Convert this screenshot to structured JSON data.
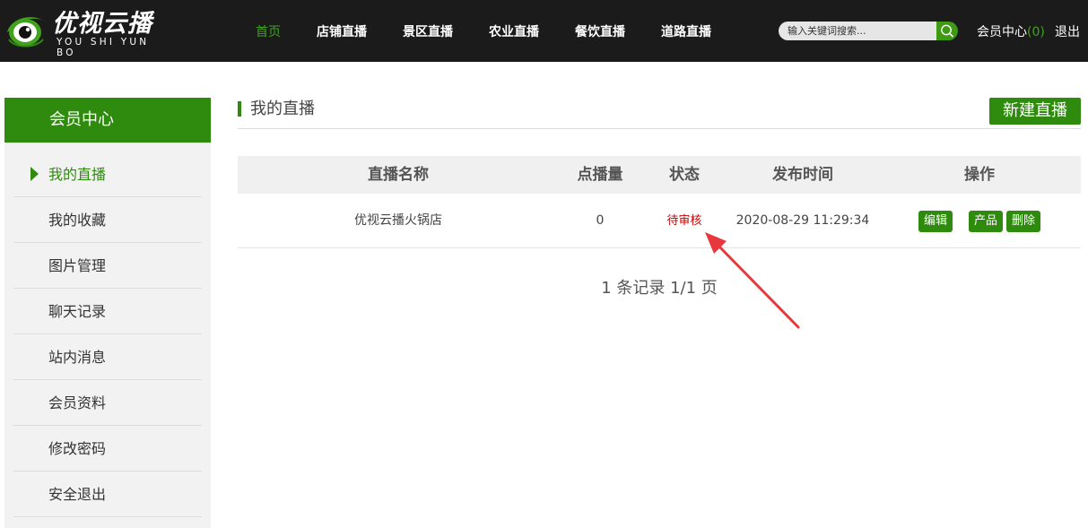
{
  "logo": {
    "name_cn": "优视云播",
    "name_en": "YOU SHI YUN BO",
    "brand_color": "#41a21b"
  },
  "nav": {
    "items": [
      {
        "label": "首页",
        "active": true
      },
      {
        "label": "店铺直播",
        "active": false
      },
      {
        "label": "景区直播",
        "active": false
      },
      {
        "label": "农业直播",
        "active": false
      },
      {
        "label": "餐饮直播",
        "active": false
      },
      {
        "label": "道路直播",
        "active": false
      }
    ]
  },
  "search": {
    "placeholder": "输入关键词搜索...",
    "icon": "search-icon"
  },
  "header_links": {
    "member_center": "会员中心",
    "member_count_open": "(",
    "member_count": "0",
    "member_count_close": ")",
    "logout": "退出"
  },
  "sidebar": {
    "title": "会员中心",
    "items": [
      {
        "label": "我的直播",
        "active": true
      },
      {
        "label": "我的收藏",
        "active": false
      },
      {
        "label": "图片管理",
        "active": false
      },
      {
        "label": "聊天记录",
        "active": false
      },
      {
        "label": "站内消息",
        "active": false
      },
      {
        "label": "会员资料",
        "active": false
      },
      {
        "label": "修改密码",
        "active": false
      },
      {
        "label": "安全退出",
        "active": false
      }
    ]
  },
  "main": {
    "title": "我的直播",
    "new_button": "新建直播",
    "table": {
      "headers": {
        "name": "直播名称",
        "views": "点播量",
        "status": "状态",
        "time": "发布时间",
        "ops": "操作"
      },
      "rows": [
        {
          "name": "优视云播火锅店",
          "views": "0",
          "status": "待审核",
          "time": "2020-08-29 11:29:34",
          "ops": {
            "edit": "编辑",
            "product": "产品",
            "delete": "删除"
          }
        }
      ]
    },
    "pager": "1 条记录 1/1 页"
  },
  "colors": {
    "header_bg": "#1b1b1b",
    "accent_green": "#2e8b0e",
    "status_pending": "#cc0000",
    "annotation_arrow": "#e8383d"
  }
}
